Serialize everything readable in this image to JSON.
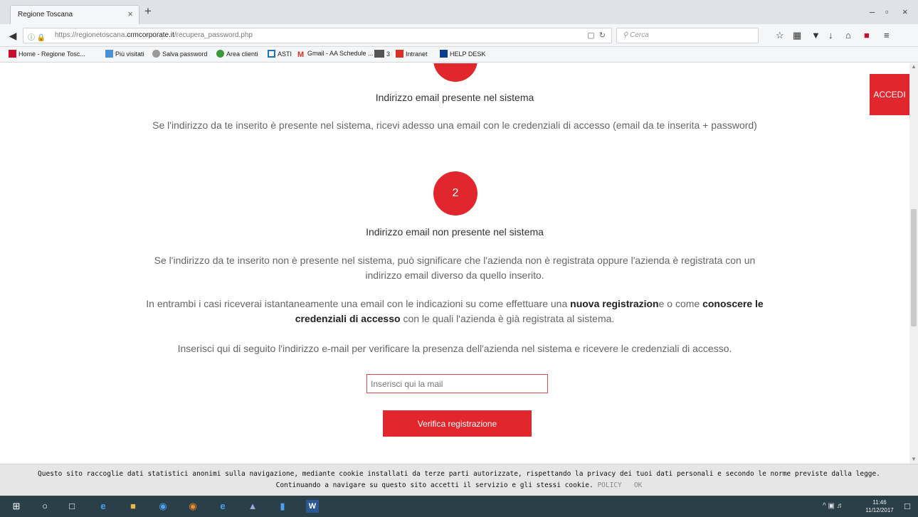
{
  "browser": {
    "tab_title": "Regione Toscana",
    "tab_close": "×",
    "new_tab": "+",
    "window_controls": [
      "–",
      "▫",
      "×"
    ],
    "url_prefix": "https://regionetoscana.",
    "url_domain": "crmcorporate.it",
    "url_path": "/recupera_password.php",
    "search_placeholder": "Cerca",
    "bookmarks": [
      {
        "label": "Home - Regione Tosc...",
        "color": "#c8102e"
      },
      {
        "label": "Più visitati",
        "color": "#4a90d9"
      },
      {
        "label": "Salva password",
        "color": "#777777"
      },
      {
        "label": "Area clienti",
        "color": "#3a9a3a"
      },
      {
        "label": "ASTI",
        "color": "#1e73be"
      },
      {
        "label": "Gmail - AA Schedule ...",
        "color": "#d93025"
      },
      {
        "label": "3",
        "color": "#555555"
      },
      {
        "label": "Intranet",
        "color": "#d93025"
      },
      {
        "label": "HELP DESK",
        "color": "#0b3d91"
      }
    ]
  },
  "page": {
    "accedi_label": "ACCEDI",
    "section1": {
      "heading": "Indirizzo email presente nel sistema",
      "text": "Se l'indirizzo da te inserito è presente nel sistema, ricevi adesso una email con le credenziali di accesso (email da te inserita + password)"
    },
    "section2": {
      "step": "2",
      "heading": "Indirizzo email non presente nel sistema",
      "text_line1": "Se l'indirizzo da te inserito non è presente nel sistema, può significare che l'azienda non è registrata oppure l'azienda è registrata con un",
      "text_line2": "indirizzo email diverso da quello inserito.",
      "both_pre": "In entrambi i casi riceverai istantaneamente una email con le indicazioni su come effettuare una ",
      "both_bold1": "nuova registrazion",
      "both_mid": "e o come ",
      "both_bold2": "conoscere le",
      "both_bold3": "credenziali di accesso",
      "both_post": " con le quali l'azienda è già registrata al sistema.",
      "instruction": "Inserisci qui di seguito l'indirizzo e-mail per verificare la presenza dell'azienda nel sistema e ricevere le credenziali di accesso.",
      "email_placeholder": "Inserisci qui la mail",
      "verify_label": "Verifica registrazione"
    }
  },
  "cookie": {
    "line1": "Questo sito raccoglie dati statistici anonimi sulla navigazione, mediante cookie installati da terze parti autorizzate, rispettando la privacy dei tuoi dati personali e secondo le norme previste dalla legge.",
    "line2": "Continuando a navigare su questo sito accetti il servizio e gli stessi cookie.",
    "policy": "POLICY",
    "ok": "OK"
  },
  "taskbar": {
    "time": "11:46",
    "date": "11/12/2017"
  },
  "colors": {
    "accent_red": "#e1262e",
    "taskbar": "#2b3f48"
  }
}
